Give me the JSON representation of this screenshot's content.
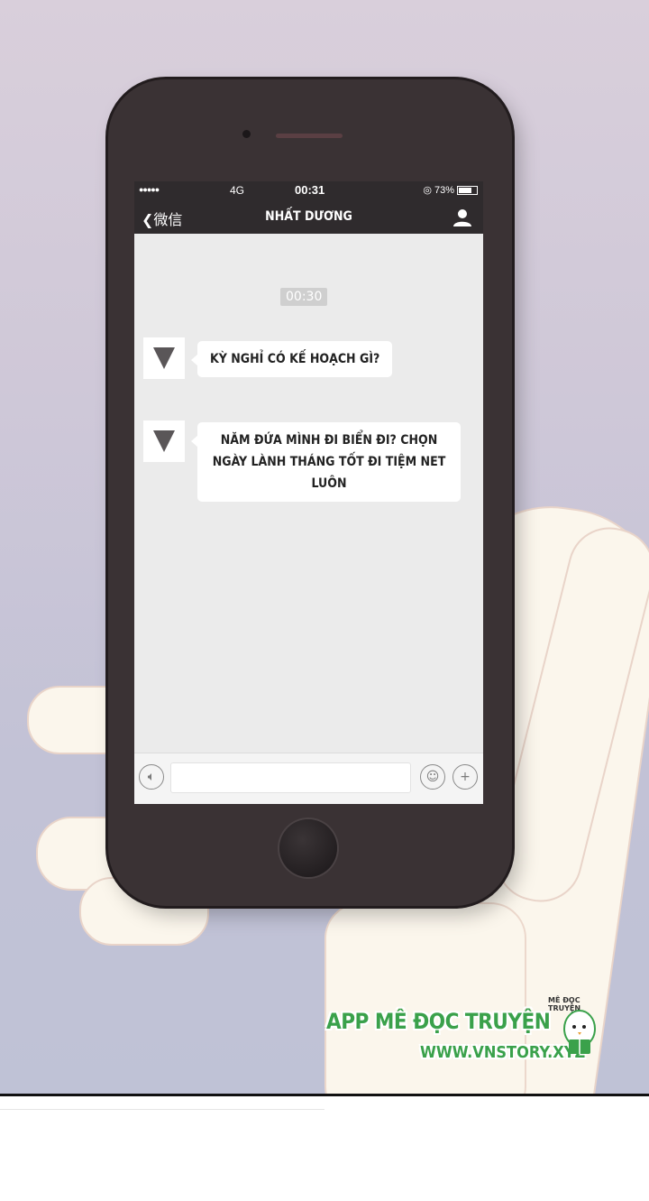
{
  "status": {
    "signal": "●●●●●",
    "network": "4G",
    "time": "00:31",
    "battery": "73%"
  },
  "nav": {
    "back_label": "微信",
    "title": "NHẤT DƯƠNG"
  },
  "chat": {
    "timestamp": "00:30",
    "messages": [
      {
        "text": "KỲ NGHỈ CÓ KẾ HOẠCH GÌ?"
      },
      {
        "text": "NĂM ĐỨA MÌNH ĐI BIỂN ĐI? CHỌN NGÀY LÀNH THÁNG TỐT ĐI TIỆM NET LUÔN"
      }
    ]
  },
  "watermark": {
    "app": "APP MÊ ĐỌC TRUYỆN",
    "site": "WWW.VNSTORY.XYZ",
    "small": "MÊ ĐỌC TRUYỆN"
  },
  "colors": {
    "bar": "#2f2b2d",
    "chat_bg": "#ebebeb",
    "brand_green": "#3aa14b"
  }
}
